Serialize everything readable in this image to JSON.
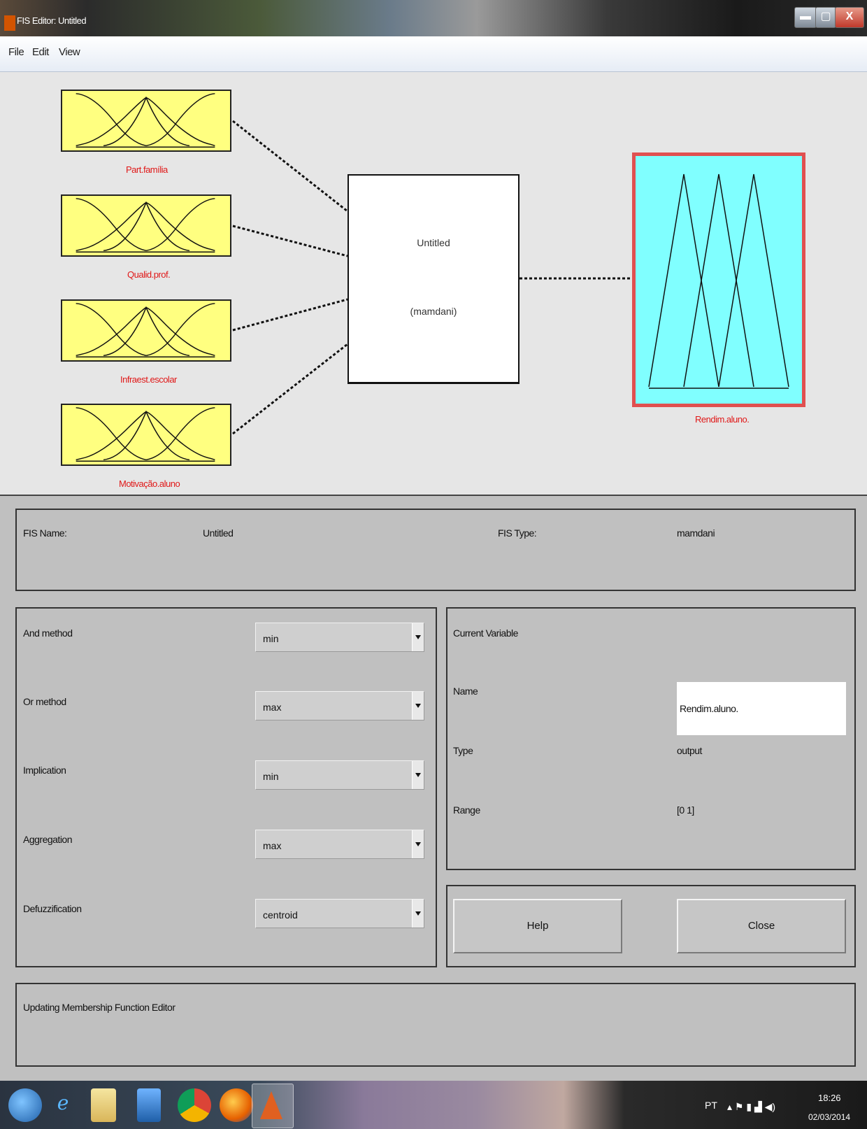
{
  "window": {
    "title": "FIS Editor: Untitled",
    "controls": {
      "minimize": "▬",
      "maximize": "▢",
      "close": "X"
    }
  },
  "menu": {
    "items": [
      "File",
      "Edit",
      "View"
    ]
  },
  "diagram": {
    "inputs": [
      {
        "label": "Part.família"
      },
      {
        "label": "Qualid.prof."
      },
      {
        "label": "Infraest.escolar"
      },
      {
        "label": "Motivação.aluno"
      }
    ],
    "rule_block": {
      "name": "Untitled",
      "type": "(mamdani)"
    },
    "output": {
      "label": "Rendim.aluno."
    },
    "colors": {
      "input_fill": "#ffff80",
      "output_fill": "#80ffff",
      "output_border": "#e05050",
      "label": "#e01818"
    }
  },
  "fis": {
    "name_label": "FIS Name:",
    "name_value": "Untitled",
    "type_label": "FIS Type:",
    "type_value": "mamdani"
  },
  "methods": [
    {
      "label": "And method",
      "value": "min"
    },
    {
      "label": "Or method",
      "value": "max"
    },
    {
      "label": "Implication",
      "value": "min"
    },
    {
      "label": "Aggregation",
      "value": "max"
    },
    {
      "label": "Defuzzification",
      "value": "centroid"
    }
  ],
  "current_variable": {
    "title": "Current Variable",
    "name_label": "Name",
    "name_value": "Rendim.aluno.",
    "type_label": "Type",
    "type_value": "output",
    "range_label": "Range",
    "range_value": "[0 1]"
  },
  "buttons": {
    "help": "Help",
    "close": "Close"
  },
  "status": {
    "message": "Updating Membership Function Editor"
  },
  "taskbar": {
    "apps": [
      "windows-start",
      "internet-explorer",
      "notepad",
      "media-player",
      "chrome",
      "firefox",
      "matlab"
    ],
    "tray_language": "PT",
    "time": "18:26",
    "date": "02/03/2014"
  }
}
